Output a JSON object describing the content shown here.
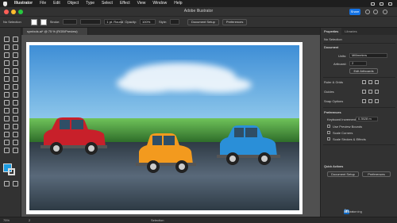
{
  "menubar": {
    "app_name": "Illustrator",
    "items": [
      "File",
      "Edit",
      "Object",
      "Type",
      "Select",
      "Effect",
      "View",
      "Window",
      "Help"
    ]
  },
  "titlebar": {
    "title": "Adobe Illustrator",
    "share_label": "Share"
  },
  "controlbar": {
    "selection": "No Selection",
    "stroke_label": "Stroke:",
    "stroke_profile": "1 pt. Round",
    "opacity_label": "Opacity:",
    "opacity_value": "100%",
    "style_label": "Style:",
    "document_setup": "Document Setup",
    "preferences": "Preferences"
  },
  "document": {
    "tab_label": "symbols.ai* @ 75 % (RGB/Preview)"
  },
  "panel": {
    "tabs": [
      "Properties",
      "Libraries"
    ],
    "no_selection": "No Selection",
    "document_heading": "Document",
    "units_label": "Units:",
    "units_value": "Millimeters",
    "artboard_label": "Artboard:",
    "artboard_value": "2",
    "edit_artboards": "Edit Artboards",
    "rulers_grids": "Ruler & Grids",
    "guides": "Guides",
    "snap_options": "Snap Options",
    "preferences_heading": "Preferences",
    "keyboard_increment_label": "Keyboard Increment:",
    "keyboard_increment_value": "0.3528 m",
    "checkboxes": [
      "Use Preview Bounds",
      "Scale Corners",
      "Scale Strokes & Effects"
    ],
    "quick_actions": "Quick Actions",
    "qa_document_setup": "Document Setup",
    "qa_preferences": "Preferences"
  },
  "status": {
    "zoom": "75%",
    "artboard": "2",
    "tool": "Selection",
    "brand_prefix": "Linked",
    "brand_badge": "in",
    "brand_suffix": " Learning"
  },
  "colors": {
    "fill": "#1d9be0",
    "accent": "#1473e6",
    "red_car": "#c8202a",
    "orange_car": "#f39a1e",
    "blue_car": "#2a8fd8"
  }
}
